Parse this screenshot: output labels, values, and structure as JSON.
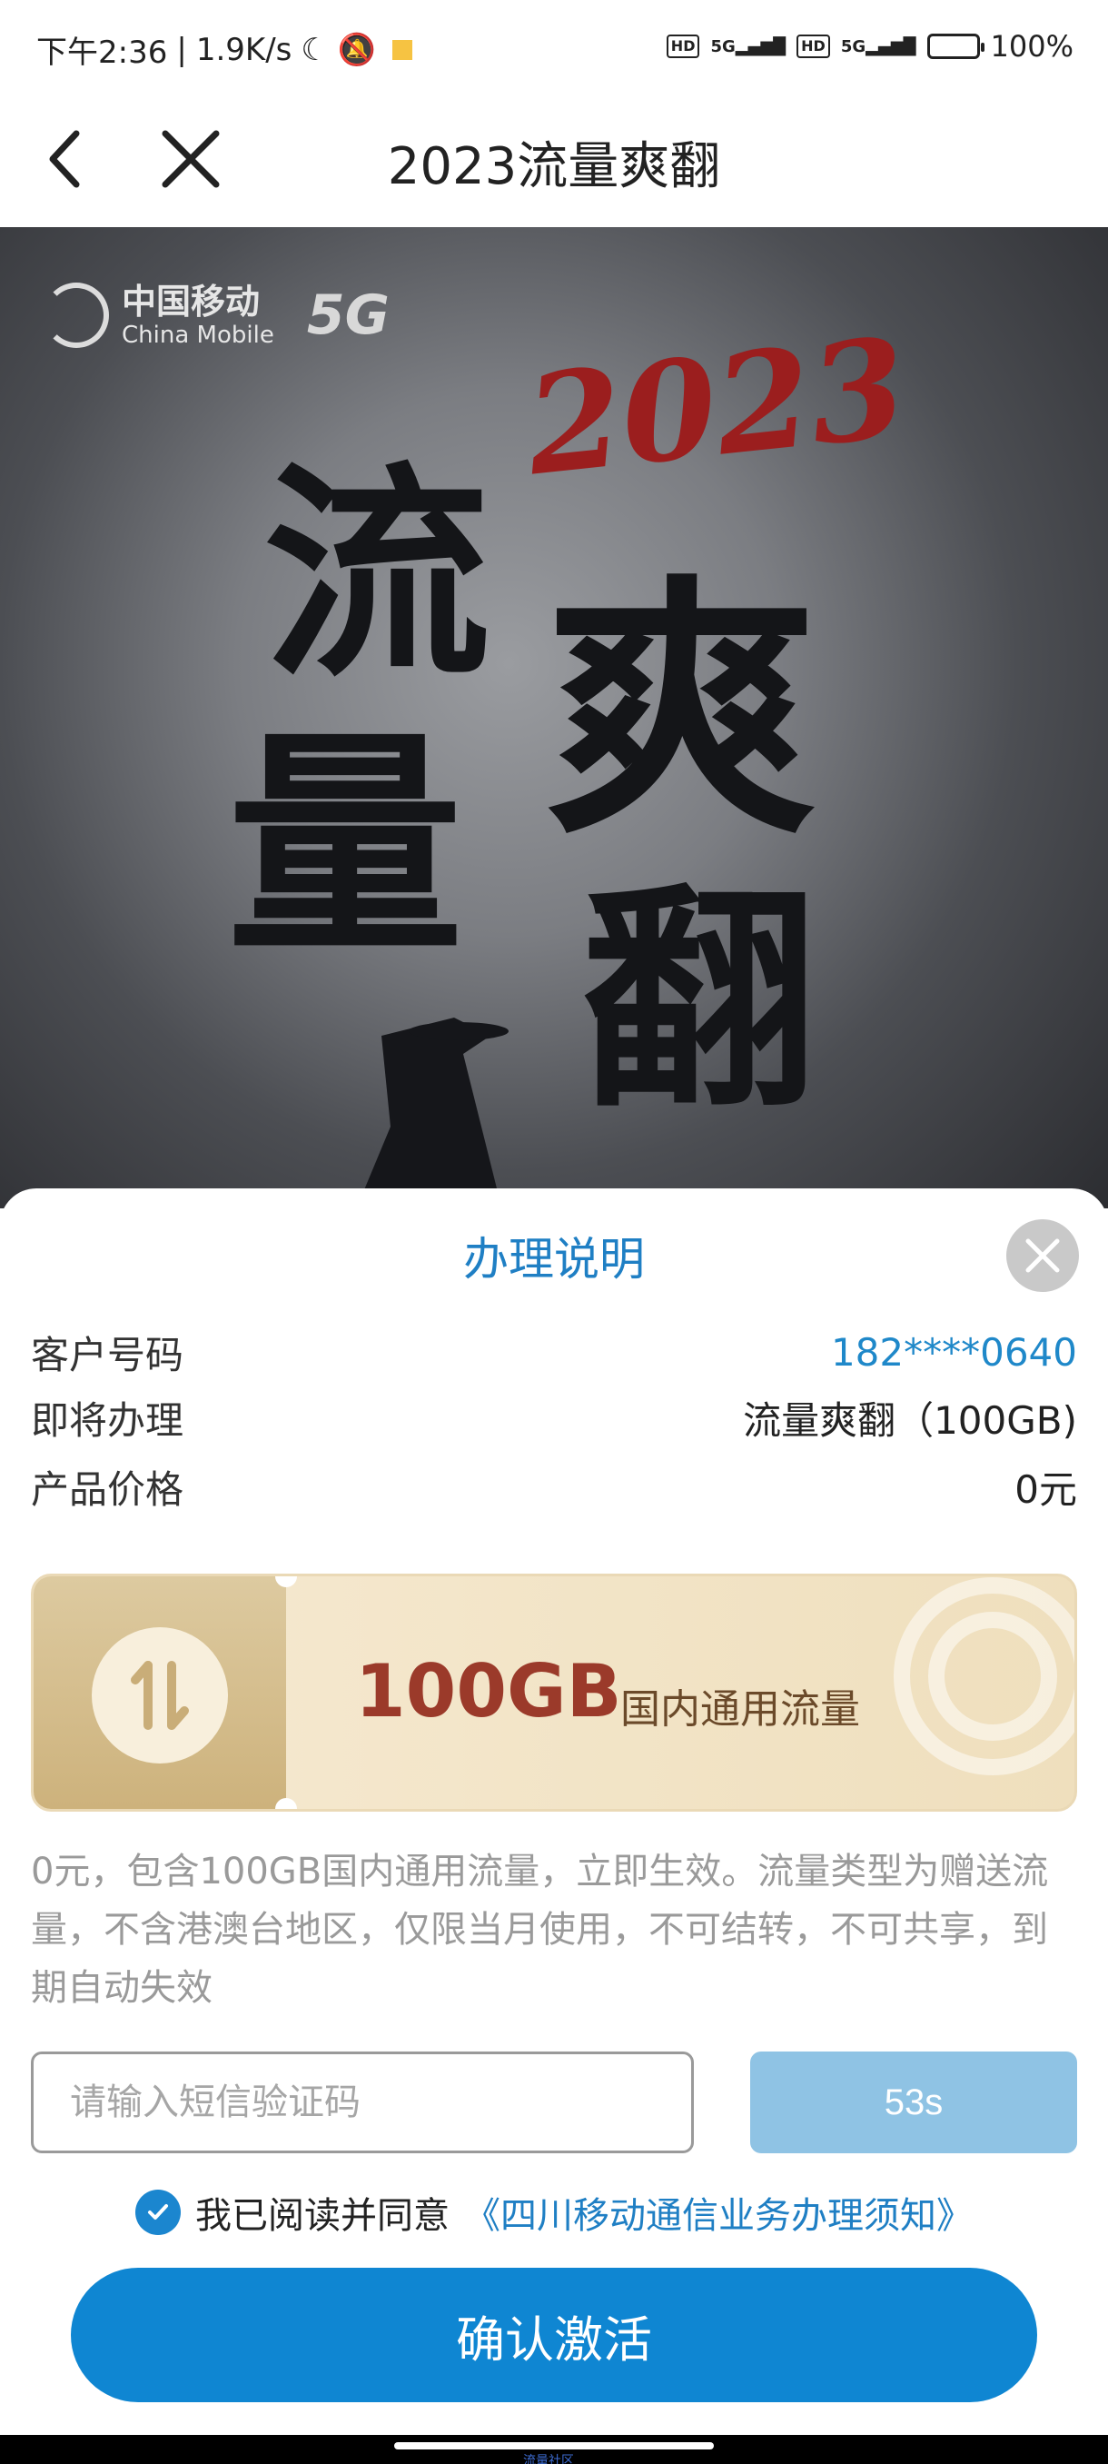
{
  "status_bar": {
    "time": "下午2:36",
    "speed": "1.9K/s",
    "hd1": "HD",
    "sig1": "5G",
    "hd2": "HD",
    "sig2": "5G",
    "battery": "100%"
  },
  "nav": {
    "title": "2023流量爽翻"
  },
  "banner": {
    "brand_cn": "中国移动",
    "brand_en": "China Mobile",
    "brand_5g": "5G",
    "year": "2023",
    "char_1": "流",
    "char_2": "量",
    "char_3": "爽",
    "char_4": "翻"
  },
  "sheet": {
    "title": "办理说明",
    "rows": [
      {
        "label": "客户号码",
        "value": "182****0640"
      },
      {
        "label": "即将办理",
        "value": "流量爽翻（100GB)"
      },
      {
        "label": "产品价格",
        "value": "0元"
      }
    ],
    "coupon": {
      "amount": "100GB",
      "desc": "国内通用流量"
    },
    "description": "0元，包含100GB国内通用流量，立即生效。流量类型为赠送流量，不含港澳台地区，仅限当月使用，不可结转，不可共享，到期自动失效",
    "otp": {
      "placeholder": "请输入短信验证码",
      "countdown": "53s"
    },
    "agreement": {
      "text": "我已阅读并同意",
      "link": "《四川移动通信业务办理须知》",
      "checked": true
    },
    "confirm_label": "确认激活"
  },
  "footer": {
    "watermark": "流量社区"
  },
  "colors": {
    "accent": "#0f86d2",
    "link": "#1f7fc4",
    "countdown_btn": "#8fc3e4",
    "coupon_text": "#9b3a2a"
  }
}
